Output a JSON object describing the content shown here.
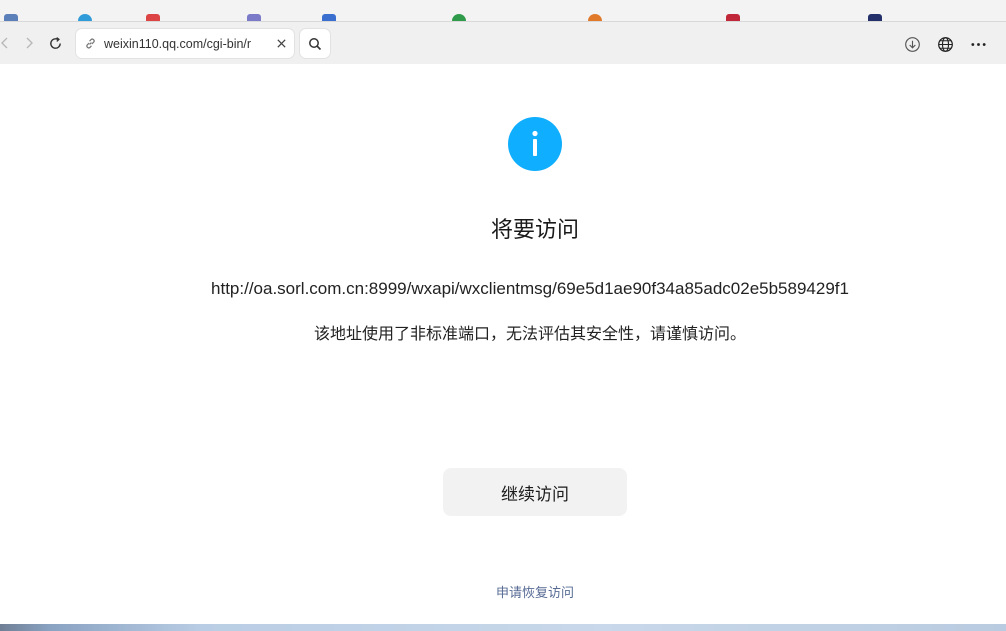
{
  "browser": {
    "address": {
      "url": "weixin110.qq.com/cgi-bin/r"
    },
    "icons": {
      "back": "chevron-left-icon",
      "forward": "chevron-right-icon",
      "reload": "reload-icon",
      "link": "link-icon",
      "clear": "close-icon",
      "search": "search-icon",
      "download": "download-icon",
      "globe": "globe-icon",
      "more": "more-icon"
    }
  },
  "page": {
    "title": "将要访问",
    "target_url": "http://oa.sorl.com.cn:8999/wxapi/wxclientmsg/69e5d1ae90f34a85adc02e5b589429f1",
    "warning": "该地址使用了非标准端口，无法评估其安全性，请谨慎访问。",
    "continue_label": "继续访问",
    "restore_link": "申请恢复访问"
  },
  "colors": {
    "accent": "#10aeff",
    "link": "#576b95",
    "button_bg": "#f2f2f2"
  }
}
